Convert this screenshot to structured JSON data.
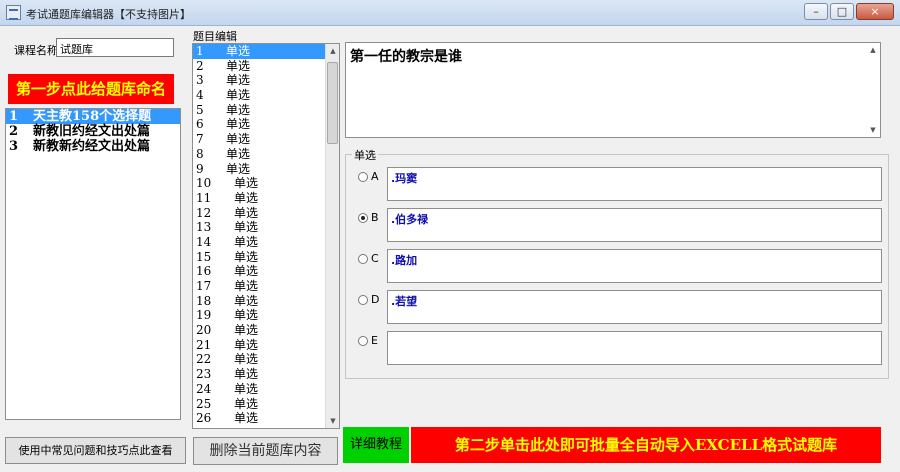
{
  "window": {
    "title": "考试通题库编辑器【不支持图片】",
    "buttons": [
      "–",
      "□",
      "×"
    ]
  },
  "course": {
    "label": "课程名称",
    "value": "试题库"
  },
  "step1_label": "第一步点此给题库命名",
  "banks": [
    {
      "num": "1",
      "name": "天主教158个选择题"
    },
    {
      "num": "2",
      "name": "新教旧约经文出处篇"
    },
    {
      "num": "3",
      "name": "新教新约经文出处篇"
    }
  ],
  "selected_bank": 1,
  "faq_label": "使用中常见问题和技巧点此查看",
  "editor": {
    "group_label": "题目编辑",
    "question_type": "单选",
    "question_count_visible": 26,
    "selected_question": 1,
    "question_text": "第一任的教宗是谁"
  },
  "questions": [
    {
      "num": "1",
      "type": "单选"
    },
    {
      "num": "2",
      "type": "单选"
    },
    {
      "num": "3",
      "type": "单选"
    },
    {
      "num": "4",
      "type": "单选"
    },
    {
      "num": "5",
      "type": "单选"
    },
    {
      "num": "6",
      "type": "单选"
    },
    {
      "num": "7",
      "type": "单选"
    },
    {
      "num": "8",
      "type": "单选"
    },
    {
      "num": "9",
      "type": "单选"
    },
    {
      "num": "10",
      "type": "单选"
    },
    {
      "num": "11",
      "type": "单选"
    },
    {
      "num": "12",
      "type": "单选"
    },
    {
      "num": "13",
      "type": "单选"
    },
    {
      "num": "14",
      "type": "单选"
    },
    {
      "num": "15",
      "type": "单选"
    },
    {
      "num": "16",
      "type": "单选"
    },
    {
      "num": "17",
      "type": "单选"
    },
    {
      "num": "18",
      "type": "单选"
    },
    {
      "num": "19",
      "type": "单选"
    },
    {
      "num": "20",
      "type": "单选"
    },
    {
      "num": "21",
      "type": "单选"
    },
    {
      "num": "22",
      "type": "单选"
    },
    {
      "num": "23",
      "type": "单选"
    },
    {
      "num": "24",
      "type": "单选"
    },
    {
      "num": "25",
      "type": "单选"
    },
    {
      "num": "26",
      "type": "单选"
    }
  ],
  "options": {
    "group_label": "单选",
    "selected": "B",
    "items": [
      {
        "letter": "A",
        "text": ".玛窦"
      },
      {
        "letter": "B",
        "text": ".伯多禄"
      },
      {
        "letter": "C",
        "text": ".路加"
      },
      {
        "letter": "D",
        "text": ".若望"
      },
      {
        "letter": "E",
        "text": ""
      }
    ]
  },
  "buttons": {
    "delete": "删除当前题库内容",
    "tutorial": "详细教程",
    "step2": "第二步单击此处即可批量全自动导入EXCELL格式试题库"
  }
}
